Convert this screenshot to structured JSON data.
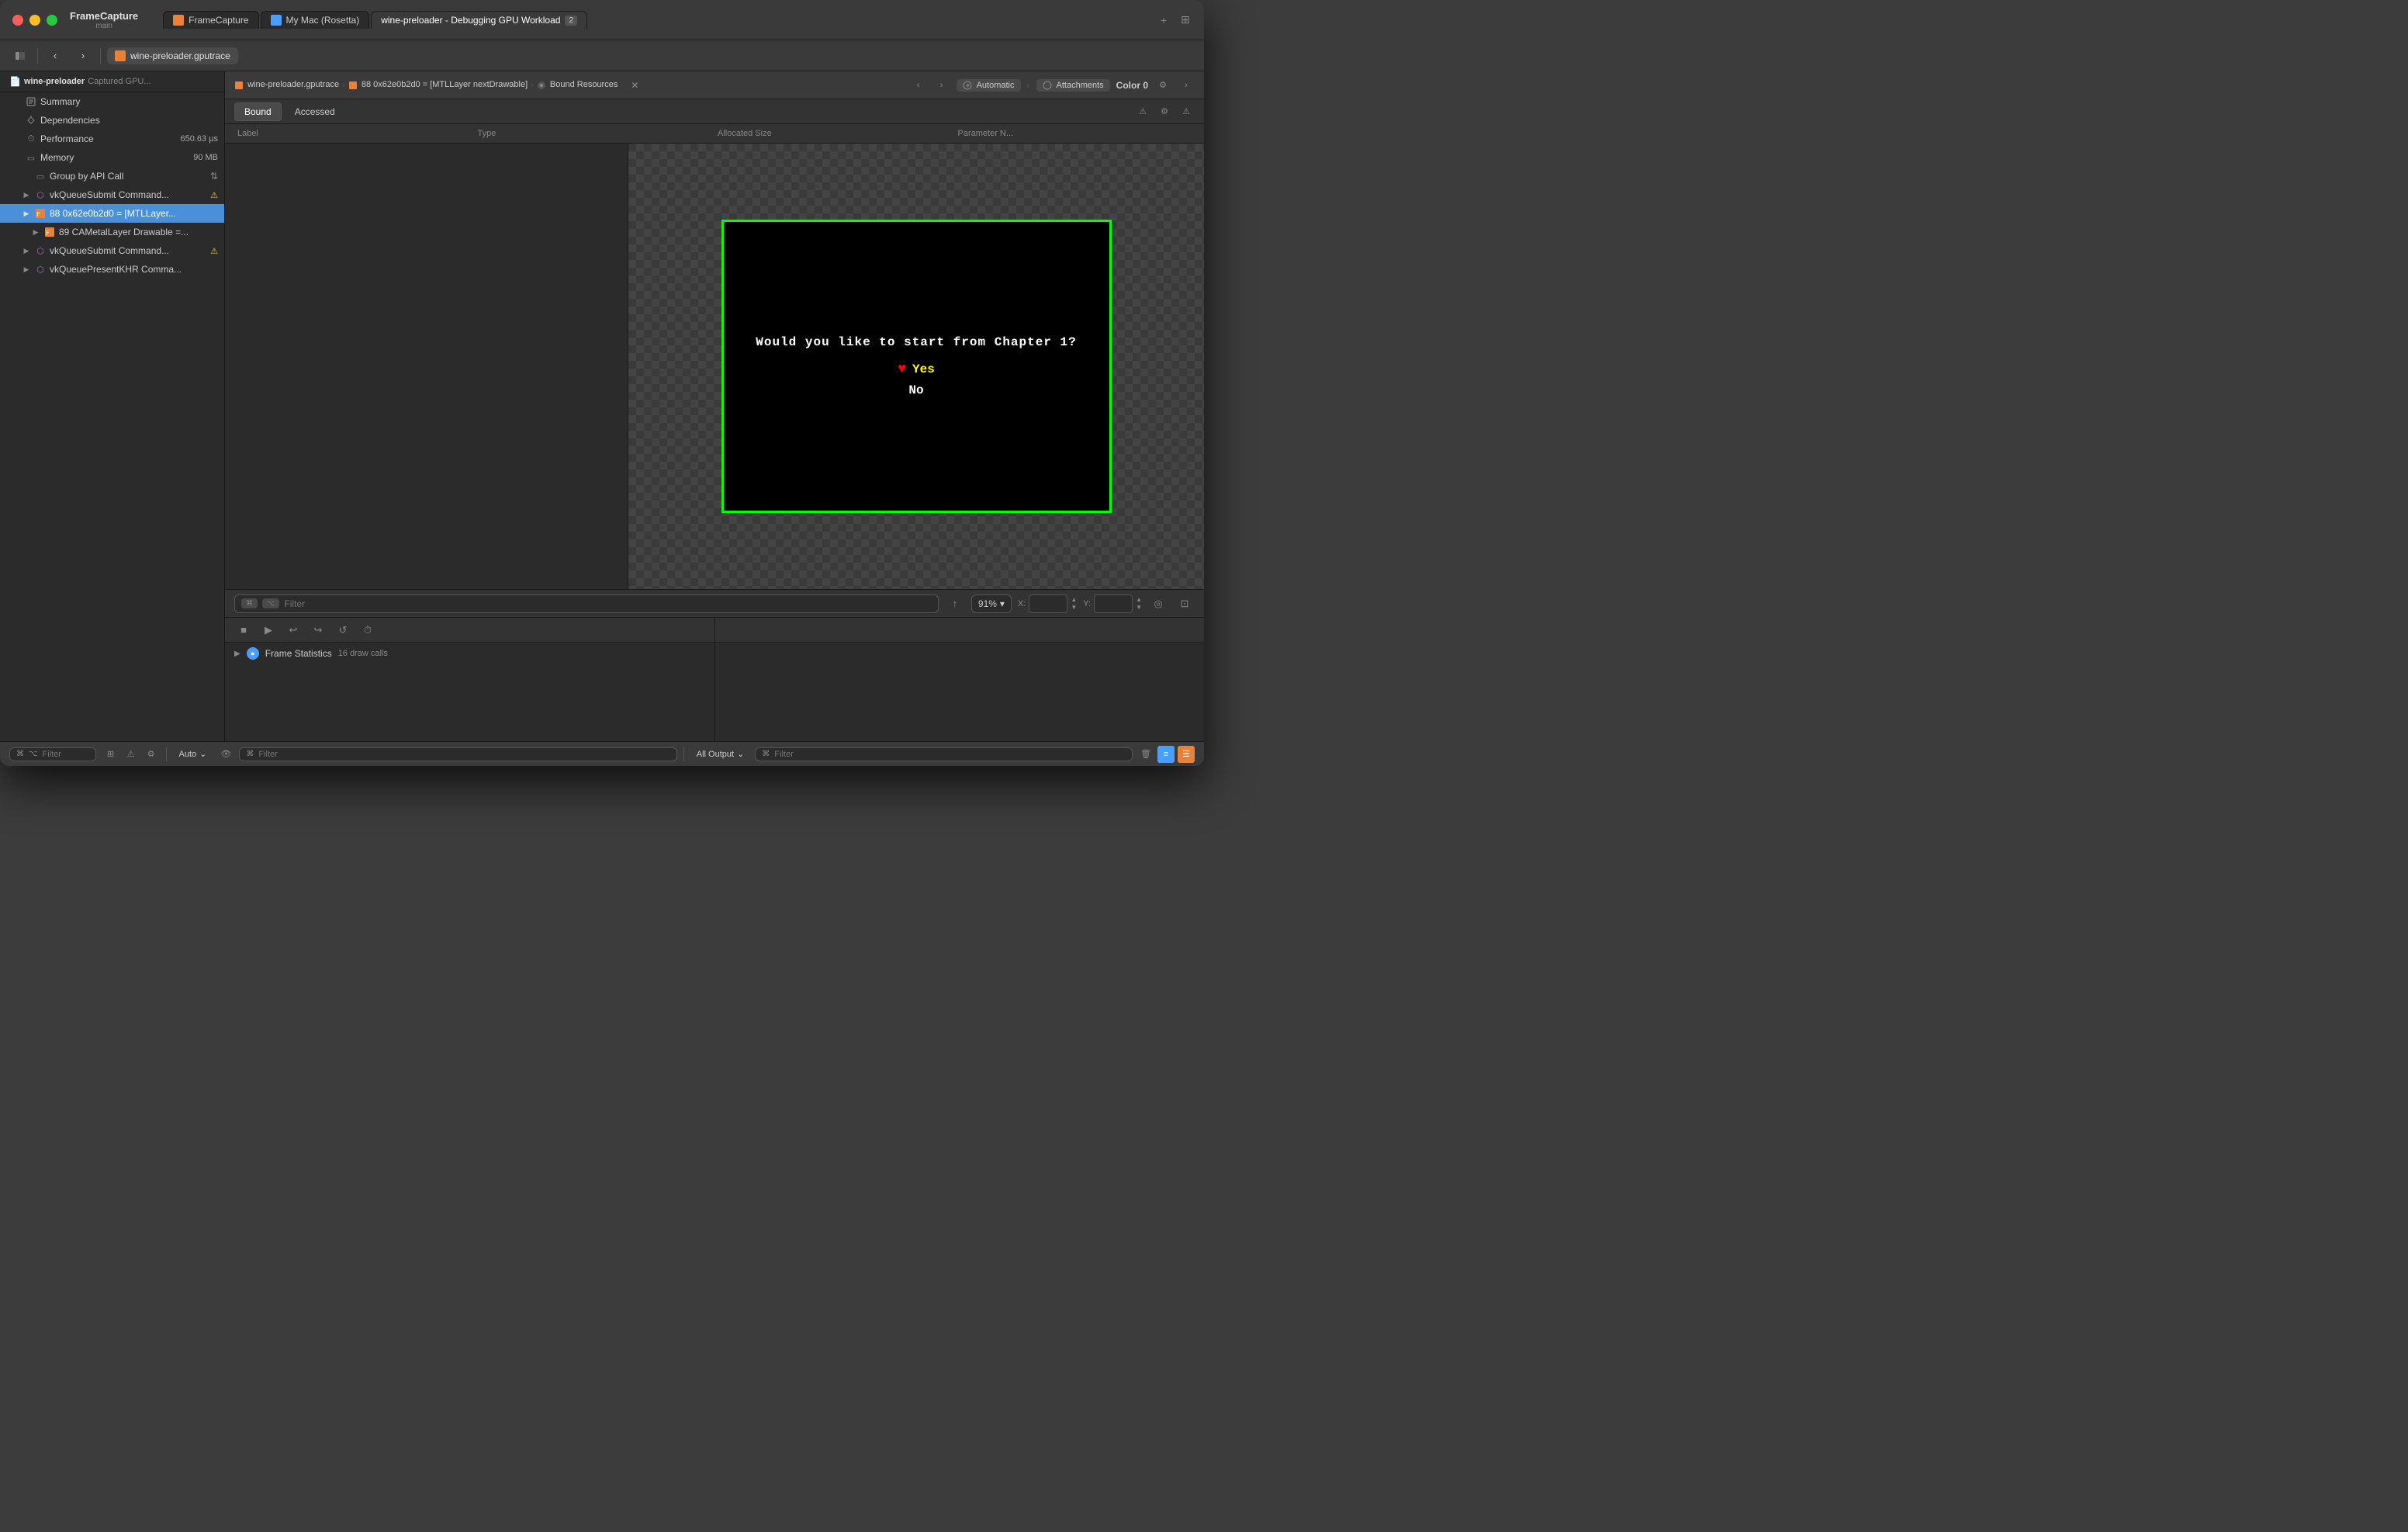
{
  "window": {
    "title": "FrameCapture",
    "subtitle": "main"
  },
  "tabs": [
    {
      "id": "framecapture",
      "label": "FrameCapture",
      "icon": "orange",
      "active": false
    },
    {
      "id": "mymac",
      "label": "My Mac (Rosetta)",
      "icon": "blue",
      "active": false
    },
    {
      "id": "workload",
      "label": "wine-preloader - Debugging GPU Workload",
      "badge": "2",
      "active": true
    }
  ],
  "toolbar": {
    "file_tab": "wine-preloader.gputrace"
  },
  "sidebar": {
    "app_name": "wine-preloader",
    "app_subtitle": "Captured GPU...",
    "items": [
      {
        "id": "summary",
        "label": "Summary",
        "indent": 1,
        "icon": "doc"
      },
      {
        "id": "dependencies",
        "label": "Dependencies",
        "indent": 1,
        "icon": "arrow"
      },
      {
        "id": "performance",
        "label": "Performance",
        "indent": 1,
        "icon": "clock",
        "value": "650.63 µs"
      },
      {
        "id": "memory",
        "label": "Memory",
        "indent": 1,
        "icon": "mem",
        "value": "90 MB"
      },
      {
        "id": "group_by_api",
        "label": "Group by API Call",
        "indent": 2,
        "icon": "dropdown",
        "dropdown": true
      },
      {
        "id": "vkqueue1",
        "label": "vkQueueSubmit Command...",
        "indent": 2,
        "icon": "cmd",
        "badge": "warning"
      },
      {
        "id": "mtllayer",
        "label": "88 0x62e0b2d0 = [MTLLayer...",
        "indent": 2,
        "icon": "frame",
        "selected": true
      },
      {
        "id": "cametallayer",
        "label": "89 CAMetalLayer Drawable =...",
        "indent": 3,
        "icon": "frame"
      },
      {
        "id": "vkqueue2",
        "label": "vkQueueSubmit Command...",
        "indent": 2,
        "icon": "cmd",
        "badge": "warning"
      },
      {
        "id": "vkqueue3",
        "label": "vkQueuePresentKHR Comma...",
        "indent": 2,
        "icon": "cmd"
      }
    ]
  },
  "breadcrumb": {
    "path": [
      "wine-preloader.gputrace",
      "88 0x62e0b2d0 = [MTLLayer nextDrawable]",
      "Bound Resources"
    ]
  },
  "panel_header": {
    "nav_prev": "‹",
    "nav_next": "›",
    "dropdown": "Automatic",
    "attachments": "Attachments",
    "color_label": "Color 0"
  },
  "content_tabs": {
    "bound": "Bound",
    "accessed": "Accessed"
  },
  "table": {
    "columns": [
      "Label",
      "Type",
      "Allocated Size",
      "Parameter N..."
    ],
    "rows": []
  },
  "game_preview": {
    "question": "Would you like to start from Chapter 1?",
    "yes_label": "Yes",
    "no_label": "No",
    "heart": "♥",
    "border_color": "#00ff00"
  },
  "filter": {
    "placeholder": "Filter",
    "zoom": "91%"
  },
  "bottom": {
    "frame_stats_label": "Frame Statistics",
    "frame_stats_calls": "16 draw calls"
  },
  "footer": {
    "filter_left": "Filter",
    "auto_label": "Auto",
    "filter_center": "Filter",
    "all_output_label": "All Output",
    "filter_right": "Filter"
  },
  "icons": {
    "chevron_right": "▶",
    "chevron_down": "▼",
    "chevron_left": "◀",
    "close": "✕",
    "plus": "+",
    "sidebar_toggle": "⊞",
    "nav_back": "‹",
    "nav_forward": "›",
    "play": "▶",
    "stop": "■",
    "warning": "⚠",
    "circle": "●",
    "gear": "⚙",
    "up": "▲",
    "down": "▼",
    "search": "⌕",
    "filter": "⌘",
    "upload": "↑",
    "target": "◎",
    "camera": "⊡",
    "stepback": "↩",
    "stepforward": "↪",
    "refresh": "↺",
    "timer": "⏱",
    "trash": "🗑",
    "eye": "👁",
    "list": "☰"
  }
}
